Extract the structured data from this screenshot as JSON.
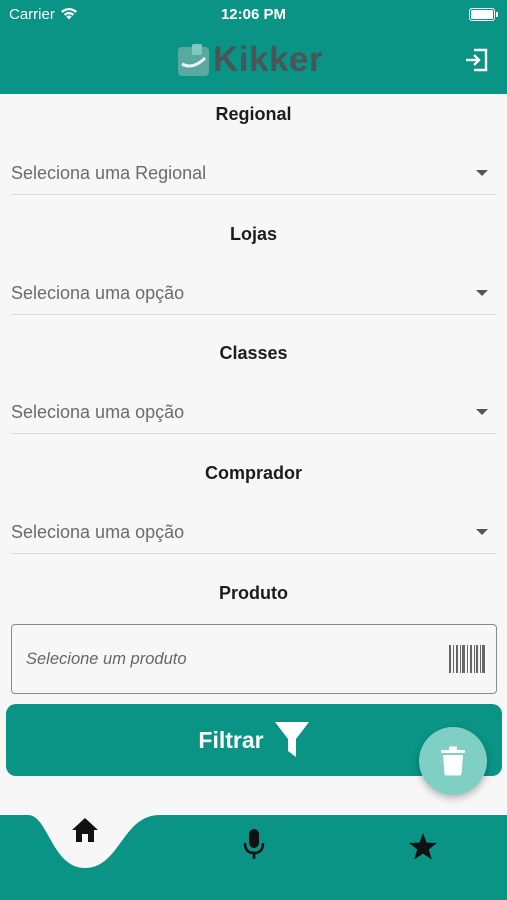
{
  "status_bar": {
    "carrier": "Carrier",
    "time": "12:06 PM"
  },
  "header": {
    "brand": "Kikker"
  },
  "sections": {
    "regional": {
      "title": "Regional",
      "value": "Seleciona uma Regional"
    },
    "lojas": {
      "title": "Lojas",
      "value": "Seleciona uma opção"
    },
    "classes": {
      "title": "Classes",
      "value": "Seleciona uma opção"
    },
    "comprador": {
      "title": "Comprador",
      "value": "Seleciona uma opção"
    },
    "produto": {
      "title": "Produto",
      "placeholder": "Selecione um produto"
    }
  },
  "filter_button": {
    "label": "Filtrar"
  },
  "colors": {
    "primary": "#0a9486",
    "fab": "#7fcfc5",
    "background": "#f7f7f7"
  },
  "bottom_nav": {
    "items": [
      {
        "icon": "home-icon",
        "active": true
      },
      {
        "icon": "microphone-icon",
        "active": false
      },
      {
        "icon": "star-icon",
        "active": false
      }
    ]
  }
}
